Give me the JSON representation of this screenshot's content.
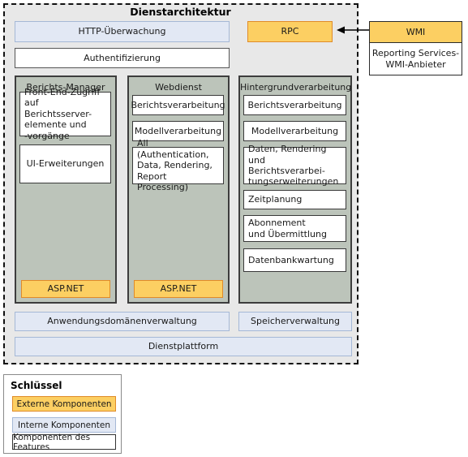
{
  "diagram": {
    "title": "Dienstarchitektur",
    "top_bars": [
      {
        "label": "HTTP-Überwachung",
        "style": "internal"
      },
      {
        "label": "Authentifizierung",
        "style": "feature"
      },
      {
        "label": "RPC",
        "style": "external"
      }
    ],
    "columns": [
      {
        "title": "Berichts-Manager",
        "items": [
          "Front-End-Zugriff\nauf Berichtsserver-\nelemente und\n-vorgänge",
          "UI-Erweiterungen"
        ],
        "footer": "ASP.NET"
      },
      {
        "title": "Webdienst",
        "items": [
          "Berichtsverarbeitung",
          "Modellverarbeitung",
          "All (Authentication,\nData, Rendering,\nReport Processing)"
        ],
        "footer": "ASP.NET"
      },
      {
        "title": "Hintergrundverarbeitung",
        "items": [
          "Berichtsverarbeitung",
          "Modellverarbeitung",
          "Daten, Rendering und\nBerichtsverarbei-\ntungserweiterungen",
          "Zeitplanung",
          "Abonnement\nund Übermittlung",
          "Datenbankwartung"
        ],
        "footer": null
      }
    ],
    "bottom_bars": [
      {
        "label": "Anwendungsdomänenverwaltung",
        "style": "internal"
      },
      {
        "label": "Speicherverwaltung",
        "style": "internal"
      },
      {
        "label": "Dienstplattform",
        "style": "internal"
      }
    ],
    "external_group": {
      "header": "WMI",
      "body": "Reporting Services-\nWMI-Anbieter"
    }
  },
  "legend": {
    "title": "Schlüssel",
    "entries": [
      {
        "label": "Externe Komponenten",
        "style": "external"
      },
      {
        "label": "Interne Komponenten",
        "style": "internal"
      },
      {
        "label": "Komponenten des Features",
        "style": "feature"
      }
    ]
  },
  "colors": {
    "external_fill": "#fccf62",
    "external_border": "#e08b28",
    "internal_fill": "#e2e8f4",
    "internal_border": "#a5b8d6",
    "feature_fill": "#ffffff",
    "feature_border": "#555555",
    "column_fill": "#bcc4ba",
    "panel_fill": "#e8e8e8"
  }
}
